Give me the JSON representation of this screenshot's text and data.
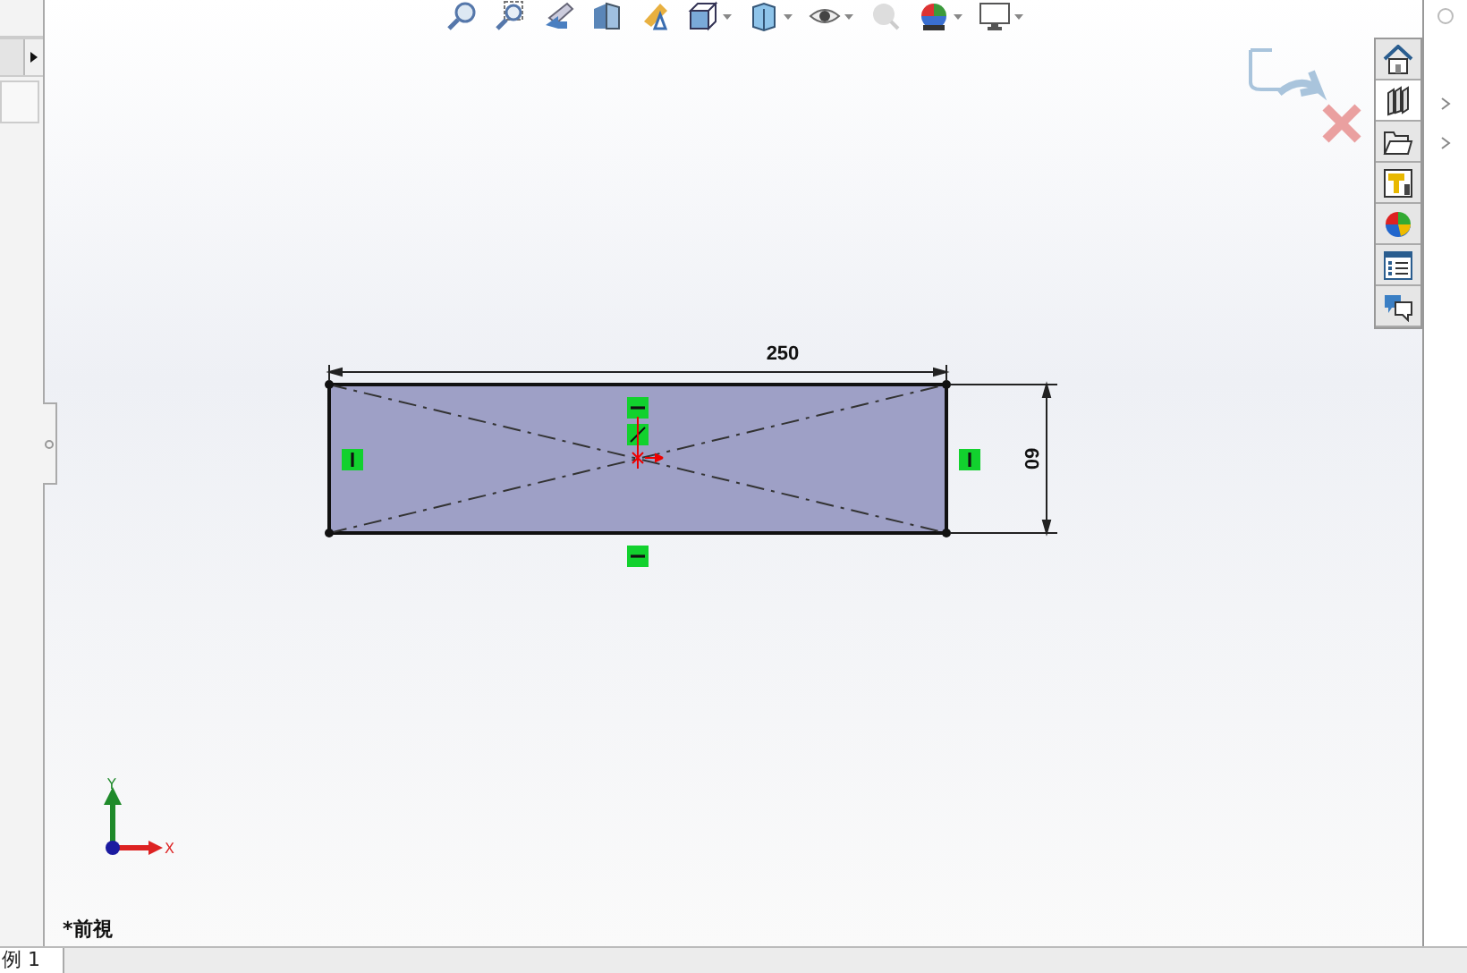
{
  "toolbar": [
    {
      "kind": "zoom-fit",
      "dropdown": false
    },
    {
      "kind": "zoom-area",
      "dropdown": false
    },
    {
      "kind": "previous-view",
      "dropdown": false
    },
    {
      "kind": "section-view",
      "dropdown": false
    },
    {
      "kind": "dynamic-annotation",
      "dropdown": false
    },
    {
      "kind": "view-orientation",
      "dropdown": true
    },
    {
      "kind": "display-style",
      "dropdown": true
    },
    {
      "kind": "hide-show",
      "dropdown": true
    },
    {
      "kind": "edit-appearance",
      "dropdown": false
    },
    {
      "kind": "scene",
      "dropdown": true
    },
    {
      "kind": "view-settings",
      "dropdown": true
    }
  ],
  "task_pane": [
    {
      "kind": "home",
      "selected": false
    },
    {
      "kind": "library",
      "selected": true
    },
    {
      "kind": "folder",
      "selected": false
    },
    {
      "kind": "palette",
      "selected": false
    },
    {
      "kind": "appearance",
      "selected": false
    },
    {
      "kind": "properties",
      "selected": false
    },
    {
      "kind": "forum",
      "selected": false
    }
  ],
  "sketch": {
    "width_dimension": "250",
    "height_dimension": "60"
  },
  "triad": {
    "x_label": "X",
    "y_label": "Y"
  },
  "view_name": "*前視",
  "bottom_tabs": [
    {
      "label": "例 1",
      "selected": true
    }
  ]
}
